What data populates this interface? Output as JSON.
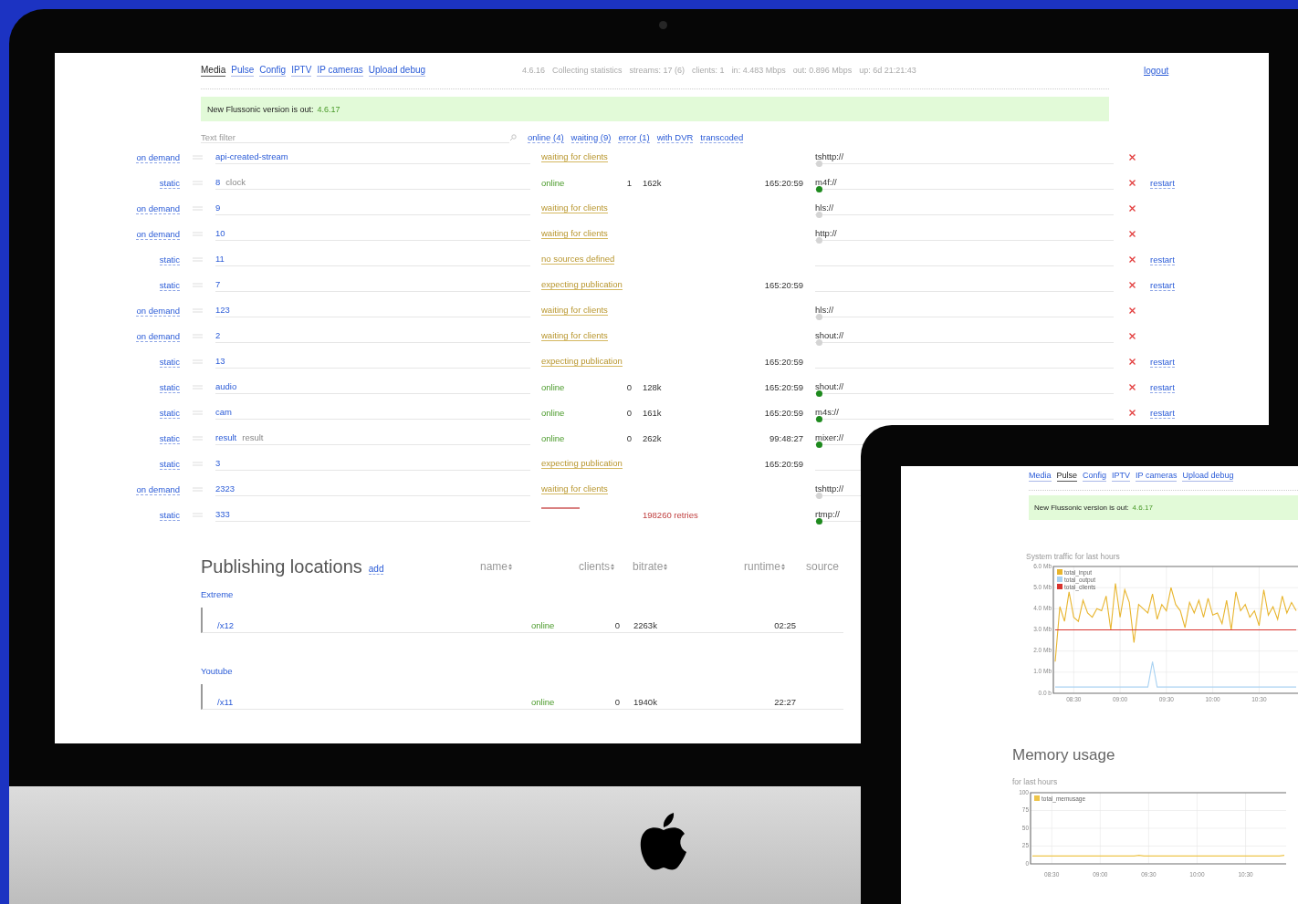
{
  "desktop": {
    "nav": [
      {
        "label": "Media",
        "selected": true
      },
      {
        "label": "Pulse",
        "selected": false
      },
      {
        "label": "Config",
        "selected": false
      },
      {
        "label": "IPTV",
        "selected": false
      },
      {
        "label": "IP cameras",
        "selected": false
      },
      {
        "label": "Upload debug",
        "selected": false
      }
    ],
    "stats": [
      "4.6.16",
      "Collecting statistics",
      "streams: 17 (6)",
      "clients: 1",
      "in: 4.483 Mbps",
      "out: 0.896 Mbps",
      "up: 6d 21:21:43"
    ],
    "logout": "logout",
    "banner": {
      "text": "New Flussonic version is out:",
      "version": "4.6.17"
    },
    "filter": {
      "placeholder": "Text filter"
    },
    "filter_links": [
      "online (4)",
      "waiting (9)",
      "error (1)",
      "with DVR",
      "transcoded"
    ],
    "rows": [
      {
        "kind": "pending",
        "type": "on demand",
        "name": "api-created-stream",
        "status": "waiting for clients",
        "source": "tshttp://",
        "source_active": false,
        "deletable": true
      },
      {
        "kind": "online",
        "type": "static",
        "name": "8",
        "comment": "clock",
        "status": "online",
        "clients": "1",
        "bitrate": "162k",
        "runtime": "165:20:59",
        "source": "m4f://",
        "source_active": true,
        "deletable": true,
        "restart": "restart"
      },
      {
        "kind": "pending",
        "type": "on demand",
        "name": "9",
        "status": "waiting for clients",
        "source": "hls://",
        "source_active": false,
        "deletable": true
      },
      {
        "kind": "pending",
        "type": "on demand",
        "name": "10",
        "status": "waiting for clients",
        "source": "http://",
        "source_active": false,
        "deletable": true
      },
      {
        "kind": "pending",
        "type": "static",
        "name": "11",
        "status": "no sources defined",
        "deletable": true,
        "restart": "restart"
      },
      {
        "kind": "pending",
        "type": "static",
        "name": "7",
        "status": "expecting publication",
        "runtime": "165:20:59",
        "deletable": true,
        "restart": "restart"
      },
      {
        "kind": "pending",
        "type": "on demand",
        "name": "123",
        "status": "waiting for clients",
        "source": "hls://",
        "source_active": false,
        "deletable": true
      },
      {
        "kind": "pending",
        "type": "on demand",
        "name": "2",
        "status": "waiting for clients",
        "source": "shout://",
        "source_active": false,
        "deletable": true
      },
      {
        "kind": "pending",
        "type": "static",
        "name": "13",
        "status": "expecting publication",
        "runtime": "165:20:59",
        "deletable": true,
        "restart": "restart"
      },
      {
        "kind": "online",
        "type": "static",
        "name": "audio",
        "status": "online",
        "clients": "0",
        "bitrate": "128k",
        "runtime": "165:20:59",
        "source": "shout://",
        "source_active": true,
        "deletable": true,
        "restart": "restart"
      },
      {
        "kind": "online",
        "type": "static",
        "name": "cam",
        "status": "online",
        "clients": "0",
        "bitrate": "161k",
        "runtime": "165:20:59",
        "source": "m4s://",
        "source_active": true,
        "deletable": true,
        "restart": "restart"
      },
      {
        "kind": "online",
        "type": "static",
        "name": "result",
        "comment": "result",
        "status": "online",
        "clients": "0",
        "bitrate": "262k",
        "runtime": "99:48:27",
        "source": "mixer://",
        "source_active": true
      },
      {
        "kind": "pending",
        "type": "static",
        "name": "3",
        "status": "expecting publication",
        "runtime": "165:20:59"
      },
      {
        "kind": "pending",
        "type": "on demand",
        "name": "2323",
        "status": "waiting for clients",
        "source": "tshttp://",
        "source_active": false
      },
      {
        "kind": "error",
        "type": "static",
        "name": "333",
        "retries": "198260 retries",
        "source": "rtmp://",
        "source_active": true
      }
    ],
    "publishing": {
      "title": "Publishing locations",
      "add": "add",
      "columns": [
        "name",
        "clients",
        "bitrate",
        "runtime",
        "source"
      ],
      "groups": [
        {
          "label": "Extreme",
          "rows": [
            {
              "name": "/x12",
              "status": "online",
              "clients": "0",
              "bitrate": "2263k",
              "runtime": "02:25"
            }
          ]
        },
        {
          "label": "Youtube",
          "rows": [
            {
              "name": "/x11",
              "status": "online",
              "clients": "0",
              "bitrate": "1940k",
              "runtime": "22:27"
            }
          ]
        }
      ]
    }
  },
  "tablet": {
    "nav": [
      {
        "label": "Media",
        "selected": false
      },
      {
        "label": "Pulse",
        "selected": true
      },
      {
        "label": "Config",
        "selected": false
      },
      {
        "label": "IPTV",
        "selected": false
      },
      {
        "label": "IP cameras",
        "selected": false
      },
      {
        "label": "Upload debug",
        "selected": false
      }
    ],
    "banner": {
      "text": "New Flussonic version is out:",
      "version": "4.6.17"
    },
    "sections": [
      {
        "chart_data": {
          "type": "line",
          "title": "System traffic for last hours",
          "ylim": [
            0,
            6
          ],
          "grid": true,
          "legend": true,
          "yticks": [
            {
              "value": 0,
              "label": "0.0 b"
            },
            {
              "value": 1,
              "label": "1.0 Mb"
            },
            {
              "value": 2,
              "label": "2.0 Mb"
            },
            {
              "value": 3,
              "label": "3.0 Mb"
            },
            {
              "value": 4,
              "label": "4.0 Mb"
            },
            {
              "value": 5,
              "label": "5.0 Mb"
            },
            {
              "value": 6,
              "label": "6.0 Mb"
            }
          ],
          "categories": [
            null,
            null,
            null,
            null,
            "08:30",
            null,
            null,
            null,
            null,
            null,
            null,
            null,
            null,
            null,
            "09:00",
            null,
            null,
            null,
            null,
            null,
            null,
            null,
            null,
            null,
            "09:30",
            null,
            null,
            null,
            null,
            null,
            null,
            null,
            null,
            null,
            "10:00",
            null,
            null,
            null,
            null,
            null,
            null,
            null,
            null,
            null,
            "10:30",
            null,
            null,
            null,
            null,
            null,
            null,
            null,
            null
          ],
          "series": [
            {
              "name": "total_input",
              "color": "#e8b52e",
              "values": [
                1.5,
                4.1,
                3.4,
                4.8,
                3.6,
                3.4,
                4.4,
                3.8,
                3.6,
                4.0,
                3.9,
                4.6,
                3.0,
                5.2,
                3.6,
                4.9,
                4.3,
                2.4,
                4.2,
                4.0,
                3.8,
                4.7,
                3.5,
                4.2,
                3.9,
                5.0,
                4.2,
                3.9,
                3.1,
                4.3,
                3.8,
                4.4,
                3.6,
                4.5,
                3.7,
                3.8,
                3.3,
                4.4,
                3.0,
                4.8,
                3.9,
                4.2,
                3.6,
                3.9,
                3.2,
                4.9,
                3.7,
                4.1,
                3.5,
                4.6,
                3.8,
                4.3,
                3.9
              ]
            },
            {
              "name": "total_output",
              "color": "#a9d2f2",
              "values": [
                0.3,
                0.3,
                0.3,
                0.3,
                0.3,
                0.3,
                0.3,
                0.3,
                0.3,
                0.3,
                0.3,
                0.3,
                0.3,
                0.3,
                0.3,
                0.3,
                0.3,
                0.3,
                0.3,
                0.3,
                0.3,
                1.5,
                0.3,
                0.3,
                0.3,
                0.3,
                0.3,
                0.3,
                0.3,
                0.3,
                0.3,
                0.3,
                0.3,
                0.3,
                0.3,
                0.3,
                0.3,
                0.3,
                0.3,
                0.3,
                0.3,
                0.3,
                0.3,
                0.3,
                0.3,
                0.3,
                0.3,
                0.3,
                0.3,
                0.3,
                0.3,
                0.3,
                0.3
              ]
            },
            {
              "name": "total_clients",
              "color": "#d9342f",
              "values": [
                3,
                3,
                3,
                3,
                3,
                3,
                3,
                3,
                3,
                3,
                3,
                3,
                3,
                3,
                3,
                3,
                3,
                3,
                3,
                3,
                3,
                3,
                3,
                3,
                3,
                3,
                3,
                3,
                3,
                3,
                3,
                3,
                3,
                3,
                3,
                3,
                3,
                3,
                3,
                3,
                3,
                3,
                3,
                3,
                3,
                3,
                3,
                3,
                3,
                3,
                3,
                3,
                3
              ]
            }
          ]
        }
      },
      {
        "heading": "Memory usage",
        "chart_data": {
          "type": "line",
          "title": "for last hours",
          "ylim": [
            0,
            100
          ],
          "grid": true,
          "legend": true,
          "yticks": [
            {
              "value": 0,
              "label": "0"
            },
            {
              "value": 25,
              "label": "25"
            },
            {
              "value": 50,
              "label": "50"
            },
            {
              "value": 75,
              "label": "75"
            },
            {
              "value": 100,
              "label": "100"
            }
          ],
          "categories": [
            null,
            null,
            null,
            null,
            "08:30",
            null,
            null,
            null,
            null,
            null,
            null,
            null,
            null,
            null,
            "09:00",
            null,
            null,
            null,
            null,
            null,
            null,
            null,
            null,
            null,
            "09:30",
            null,
            null,
            null,
            null,
            null,
            null,
            null,
            null,
            null,
            "10:00",
            null,
            null,
            null,
            null,
            null,
            null,
            null,
            null,
            null,
            "10:30",
            null,
            null,
            null,
            null,
            null,
            null,
            null,
            null
          ],
          "series": [
            {
              "name": "total_memusage",
              "color": "#eec54a",
              "values": [
                11,
                11,
                11,
                11,
                11,
                11,
                11,
                11,
                11,
                11,
                11,
                11,
                11,
                11,
                11,
                11,
                11,
                11,
                11,
                11,
                11,
                11,
                12,
                11,
                11,
                11,
                11,
                11,
                11,
                11,
                11,
                11,
                11,
                11,
                11,
                11,
                11,
                11,
                11,
                11,
                11,
                11,
                11,
                11,
                11,
                11,
                11,
                11,
                11,
                11,
                11,
                11,
                12
              ]
            }
          ]
        }
      }
    ]
  }
}
